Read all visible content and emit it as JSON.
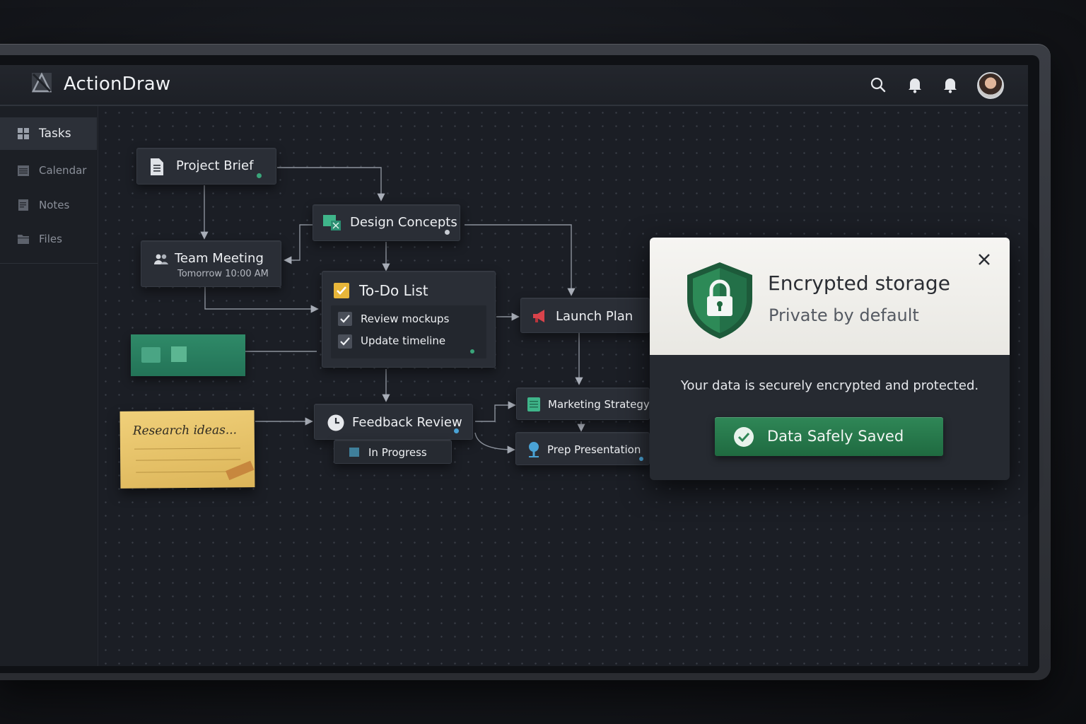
{
  "app": {
    "title": "ActionDraw"
  },
  "header": {
    "icons": [
      "search-icon",
      "bell-icon",
      "bell-icon",
      "user-avatar"
    ]
  },
  "sidebar": {
    "items": [
      {
        "label": "Tasks",
        "icon": "grid-icon",
        "active": true
      },
      {
        "label": "Calendar",
        "icon": "calendar-icon",
        "active": false
      },
      {
        "label": "Notes",
        "icon": "notes-icon",
        "active": false
      },
      {
        "label": "Files",
        "icon": "folder-icon",
        "active": false
      }
    ]
  },
  "canvas": {
    "project_brief": {
      "title": "Project Brief",
      "icon": "document-icon"
    },
    "design_concepts": {
      "title": "Design Concepts",
      "icon": "image-icon"
    },
    "team_meeting": {
      "title": "Team Meeting",
      "subtitle": "Tomorrow 10:00 AM",
      "icon": "people-icon"
    },
    "todo": {
      "title": "To-Do List",
      "items": [
        {
          "label": "Review mockups",
          "checked": true
        },
        {
          "label": "Update timeline",
          "checked": true
        }
      ]
    },
    "launch_plan": {
      "title": "Launch Plan",
      "icon": "megaphone-icon"
    },
    "sticky_note": {
      "text": "Research ideas..."
    },
    "feedback_review": {
      "title": "Feedback Review",
      "status": "In Progress",
      "icon": "clock-icon"
    },
    "marketing_strategy": {
      "title": "Marketing Strategy",
      "icon": "chart-icon"
    },
    "prep_presentation": {
      "title": "Prep Presentation",
      "icon": "pin-icon"
    }
  },
  "dialog": {
    "title": "Encrypted storage",
    "subtitle": "Private by default",
    "message": "Your data is securely encrypted and protected.",
    "button_label": "Data Safely Saved",
    "icon": "shield-lock-icon"
  },
  "colors": {
    "accent_green": "#2f8757",
    "todo_check": "#e8b63a",
    "launch_red": "#d9434b",
    "sticky_yellow": "#e7c469",
    "teal_node": "#2a7d61"
  }
}
